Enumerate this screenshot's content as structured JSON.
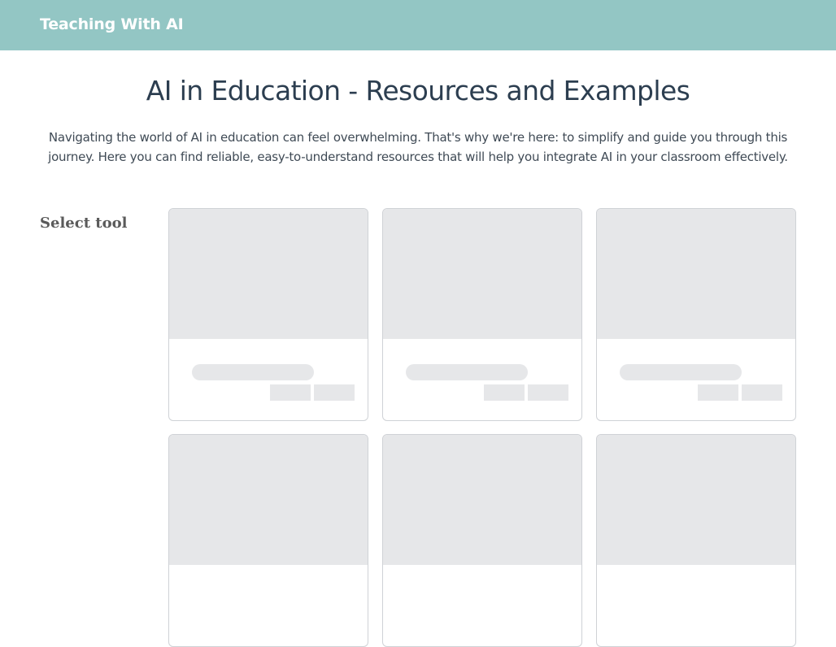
{
  "header": {
    "brand": "Teaching With AI",
    "background_color": "#93c6c4"
  },
  "main": {
    "title": "AI in Education - Resources and Examples",
    "intro": "Navigating the world of AI in education can feel overwhelming. That's why we're here: to simplify and guide you through this journey. Here you can find reliable, easy-to-understand resources that will help you integrate AI in your classroom effectively."
  },
  "filters": {
    "select_tool_label": "Select tool"
  },
  "resource_cards": {
    "state": "loading",
    "skeleton_color": "#e6e7e9",
    "cards": [
      {
        "status": "loading-placeholder"
      },
      {
        "status": "loading-placeholder"
      },
      {
        "status": "loading-placeholder"
      },
      {
        "status": "loading-placeholder"
      },
      {
        "status": "loading-placeholder"
      },
      {
        "status": "loading-placeholder"
      }
    ]
  }
}
